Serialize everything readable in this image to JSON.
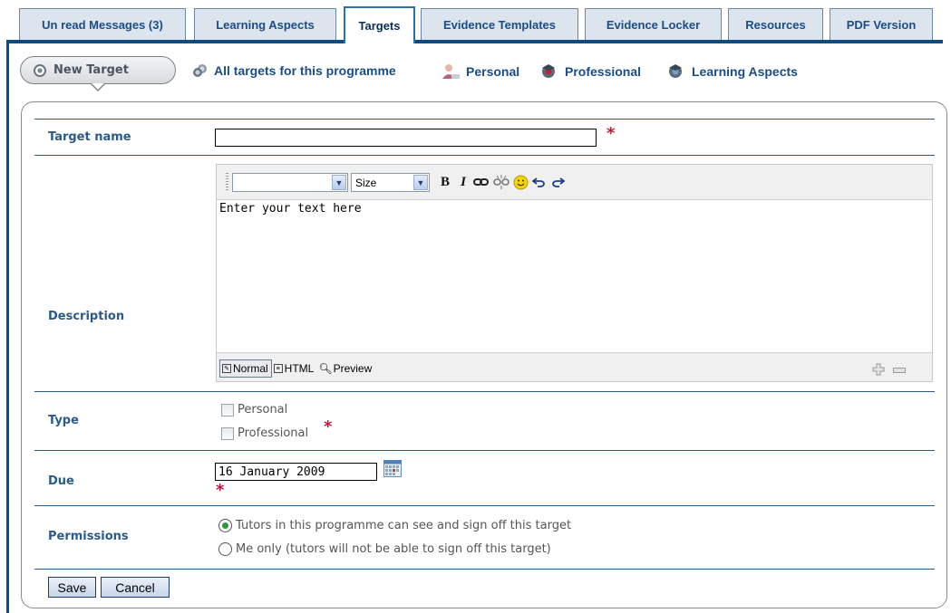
{
  "tabs": [
    {
      "label": "Un read Messages (3)"
    },
    {
      "label": "Learning Aspects"
    },
    {
      "label": "Targets",
      "active": true
    },
    {
      "label": "Evidence Templates"
    },
    {
      "label": "Evidence Locker"
    },
    {
      "label": "Resources"
    },
    {
      "label": "PDF Version"
    }
  ],
  "actions": {
    "new_target": "New Target",
    "all_targets": "All targets for this programme",
    "personal": "Personal",
    "professional": "Professional",
    "learning_aspects": "Learning Aspects"
  },
  "form": {
    "target_name": {
      "label": "Target name",
      "value": ""
    },
    "description": {
      "label": "Description",
      "font_select": "",
      "size_select": "Size",
      "body_text": "Enter your text here",
      "modes": {
        "normal": "Normal",
        "html": "HTML",
        "preview": "Preview"
      }
    },
    "type": {
      "label": "Type",
      "options": [
        {
          "label": "Personal",
          "checked": false
        },
        {
          "label": "Professional",
          "checked": false
        }
      ]
    },
    "due": {
      "label": "Due",
      "value": "16 January 2009"
    },
    "permissions": {
      "label": "Permissions",
      "options": [
        {
          "label": "Tutors in this programme can see and sign off this target",
          "checked": true
        },
        {
          "label": "Me only (tutors will not be able to sign off this target)",
          "checked": false
        }
      ]
    },
    "required_mark": "*",
    "buttons": {
      "save": "Save",
      "cancel": "Cancel"
    }
  },
  "colors": {
    "accent": "#0f4a80",
    "label": "#2a5b8a",
    "required": "#c0143c",
    "link": "#1a4d86"
  }
}
